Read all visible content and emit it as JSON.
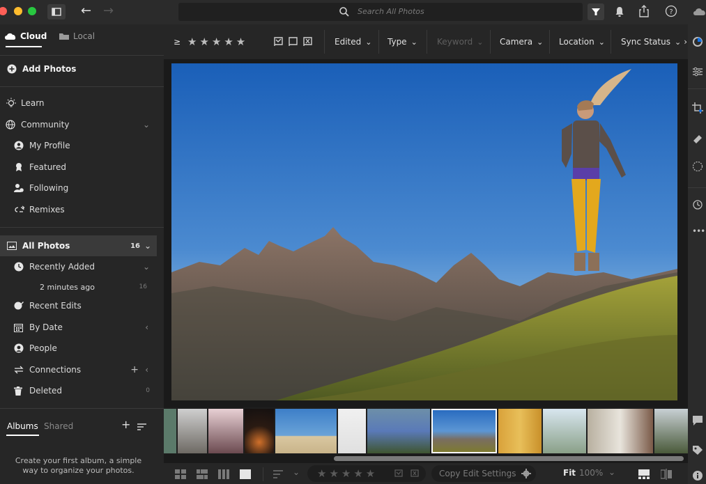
{
  "search": {
    "placeholder": "Search All Photos"
  },
  "sidebar": {
    "tabs": {
      "cloud": "Cloud",
      "local": "Local"
    },
    "add_photos": "Add Photos",
    "learn": "Learn",
    "community": "Community",
    "my_profile": "My Profile",
    "featured": "Featured",
    "following": "Following",
    "remixes": "Remixes",
    "all_photos": "All Photos",
    "all_photos_count": "16",
    "recently_added": "Recently Added",
    "recently_added_sub": "2 minutes ago",
    "recently_added_sub_count": "16",
    "recent_edits": "Recent Edits",
    "by_date": "By Date",
    "people": "People",
    "connections": "Connections",
    "deleted": "Deleted",
    "deleted_count": "0",
    "albums_tab": "Albums",
    "shared_tab": "Shared",
    "albums_empty_line1": "Create your first album, a simple",
    "albums_empty_line2": "way to organize your photos."
  },
  "filterbar": {
    "rating_op": "≥",
    "stars": "★★★★★",
    "edited": "Edited",
    "type": "Type",
    "keyword": "Keyword",
    "camera": "Camera",
    "location": "Location",
    "sync_status": "Sync Status"
  },
  "bottombar": {
    "stars": "★★★★★",
    "copy_edit_settings": "Copy Edit Settings",
    "fit": "Fit",
    "zoom": "100%"
  },
  "colors": {
    "accent": "#1473e6",
    "traffic_red": "#ff5f57",
    "traffic_yellow": "#febc2e",
    "traffic_green": "#28c840"
  }
}
